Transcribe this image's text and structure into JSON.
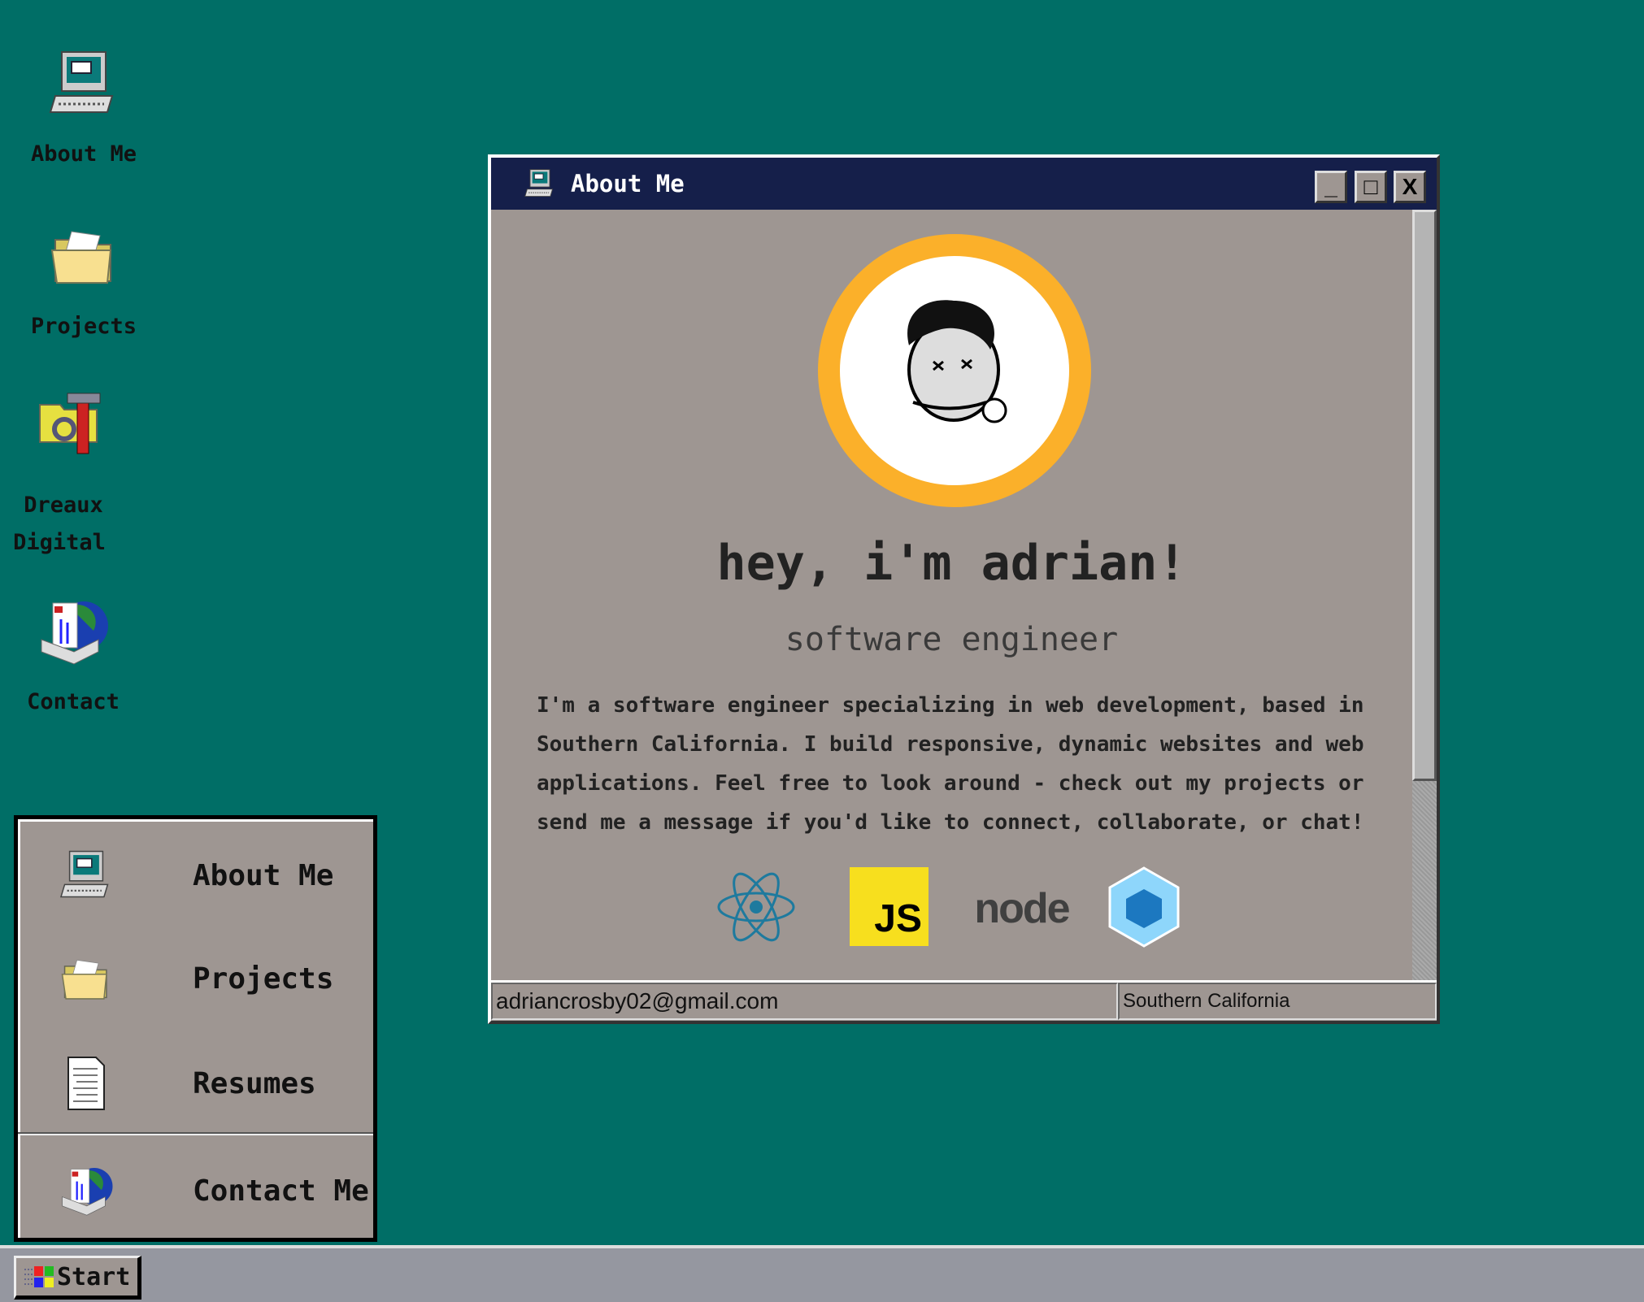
{
  "desktop": {
    "icons": [
      {
        "label": "About Me",
        "icon": "computer-icon"
      },
      {
        "label": "Projects",
        "icon": "folder-icon"
      },
      {
        "label_line1": "Dreaux",
        "label_line2": "Digital",
        "icon": "tools-folder-icon"
      },
      {
        "label": "Contact",
        "icon": "mail-globe-icon"
      }
    ]
  },
  "window": {
    "title": "About Me",
    "minimize": "_",
    "maximize": "□",
    "close": "X",
    "heading": "hey, i'm adrian!",
    "subtitle": "software engineer",
    "bio": "I'm a software engineer specializing in web development, based in Southern California. I build responsive, dynamic websites and web applications. Feel free to look around - check out my projects or send me a message if you'd like to connect, collaborate, or chat!",
    "tech": [
      "react-icon",
      "javascript-icon",
      "node-icon",
      "webpack-icon"
    ],
    "js_label": "JS",
    "node_label": "node",
    "status": {
      "email": "adriancrosby02@gmail.com",
      "location": "Southern California"
    }
  },
  "start_menu": {
    "items": [
      {
        "label": "About Me"
      },
      {
        "label": "Projects"
      },
      {
        "label": "Resumes"
      },
      {
        "label": "Contact Me"
      }
    ]
  },
  "taskbar": {
    "start_label": "Start"
  },
  "colors": {
    "desktop": "#006e66",
    "titlebar": "#151f4a",
    "window": "#9e9692",
    "accent": "#fbb02a"
  }
}
